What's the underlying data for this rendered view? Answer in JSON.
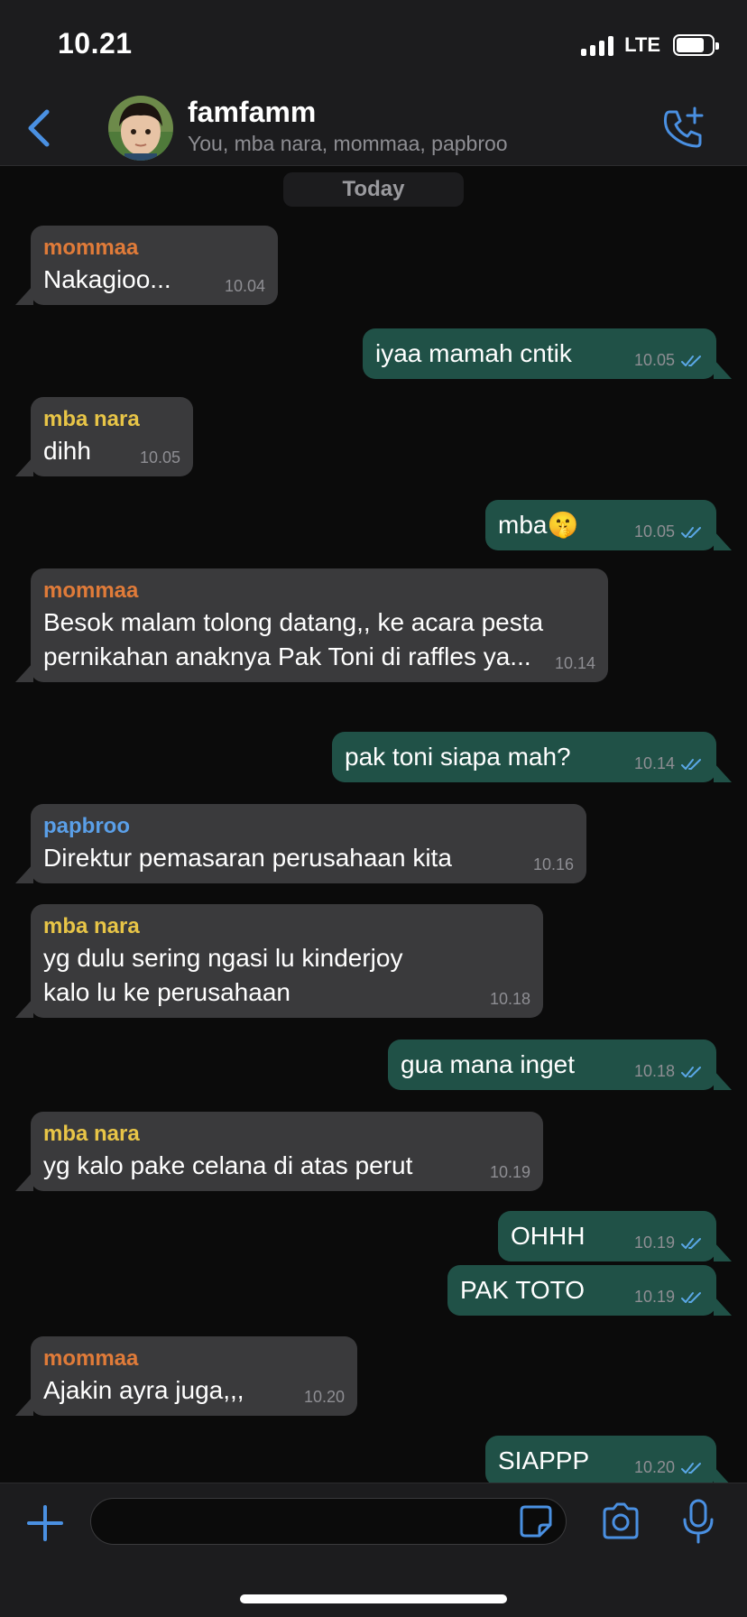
{
  "status_bar": {
    "time": "10.21",
    "network": "LTE",
    "signal_bars": 4,
    "battery_level": 0.75
  },
  "header": {
    "title": "famfamm",
    "subtitle": "You, mba nara, mommaa, papbroo",
    "back_icon": "chevron-left-icon",
    "call_icon": "phone-plus-icon"
  },
  "date_separator": "Today",
  "colors": {
    "accent": "#4a90e2",
    "incoming_bubble": "#3a3a3c",
    "outgoing_bubble": "#205147",
    "sender_mommaa": "#e07b39",
    "sender_mba_nara": "#e8c547",
    "sender_papbroo": "#5a9fe8",
    "read_ticks": "#5aa7e6"
  },
  "messages": [
    {
      "direction": "in",
      "sender": "mommaa",
      "text": "Nakagioo...",
      "time": "10.04"
    },
    {
      "direction": "out",
      "text": "iyaa mamah cntik",
      "time": "10.05",
      "read": true
    },
    {
      "direction": "in",
      "sender": "mba nara",
      "text": "dihh",
      "time": "10.05"
    },
    {
      "direction": "out",
      "text": "mba🤫",
      "time": "10.05",
      "read": true
    },
    {
      "direction": "in",
      "sender": "mommaa",
      "text": "Besok malam tolong datang,, ke acara pesta\npernikahan anaknya Pak Toni di raffles ya...",
      "time": "10.14"
    },
    {
      "direction": "out",
      "text": "pak toni siapa mah?",
      "time": "10.14",
      "read": true
    },
    {
      "direction": "in",
      "sender": "papbroo",
      "text": "Direktur pemasaran perusahaan kita",
      "time": "10.16"
    },
    {
      "direction": "in",
      "sender": "mba nara",
      "text": "yg dulu sering ngasi lu kinderjoy\nkalo lu ke perusahaan",
      "time": "10.18"
    },
    {
      "direction": "out",
      "text": "gua mana inget",
      "time": "10.18",
      "read": true
    },
    {
      "direction": "in",
      "sender": "mba nara",
      "text": "yg kalo pake celana di atas perut",
      "time": "10.19"
    },
    {
      "direction": "out",
      "text": "OHHH",
      "time": "10.19",
      "read": true
    },
    {
      "direction": "out",
      "text": "PAK TOTO",
      "time": "10.19",
      "read": true
    },
    {
      "direction": "in",
      "sender": "mommaa",
      "text": "Ajakin ayra juga,,,",
      "time": "10.20"
    },
    {
      "direction": "out",
      "text": "SIAPPP",
      "time": "10.20",
      "read": true
    }
  ],
  "input_bar": {
    "placeholder": "",
    "icons": [
      "plus-icon",
      "sticker-icon",
      "camera-icon",
      "microphone-icon"
    ]
  }
}
